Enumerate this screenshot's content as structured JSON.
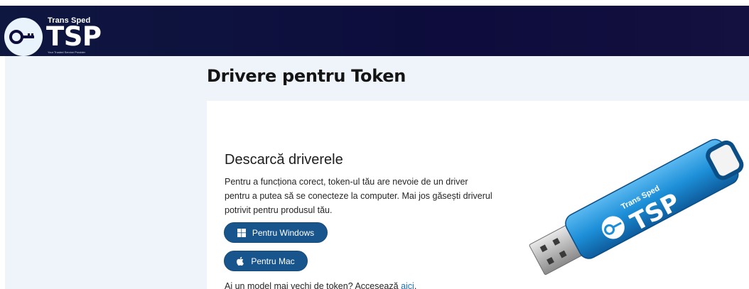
{
  "header": {
    "brand_name": "Trans Sped",
    "brand_mark": "TSP",
    "tagline": "Your Trusted Service Provider",
    "logo_icon": "key-cloud-icon"
  },
  "page": {
    "title": "Drivere pentru Token"
  },
  "download": {
    "heading": "Descarcă driverele",
    "description": "Pentru a funcționa corect, token-ul tău are nevoie de un driver pentru a putea să se conecteze la computer. Mai jos găsești driverul potrivit pentru produsul tău.",
    "windows_button": {
      "label": "Pentru Windows",
      "icon": "windows-icon"
    },
    "mac_button": {
      "label": "Pentru Mac",
      "icon": "apple-icon"
    },
    "old_token_text": "Ai un model mai vechi de token? Accesează ",
    "old_token_link": "aici",
    "old_token_suffix": "."
  },
  "product_image": {
    "brand_name": "Trans Sped",
    "brand_mark": "TSP"
  },
  "colors": {
    "header_bg": "#0d0c3c",
    "button_bg": "#19558d",
    "band_bg": "#eef4fa",
    "usb_blue": "#1d8fd8",
    "link": "#1f6fb5"
  }
}
